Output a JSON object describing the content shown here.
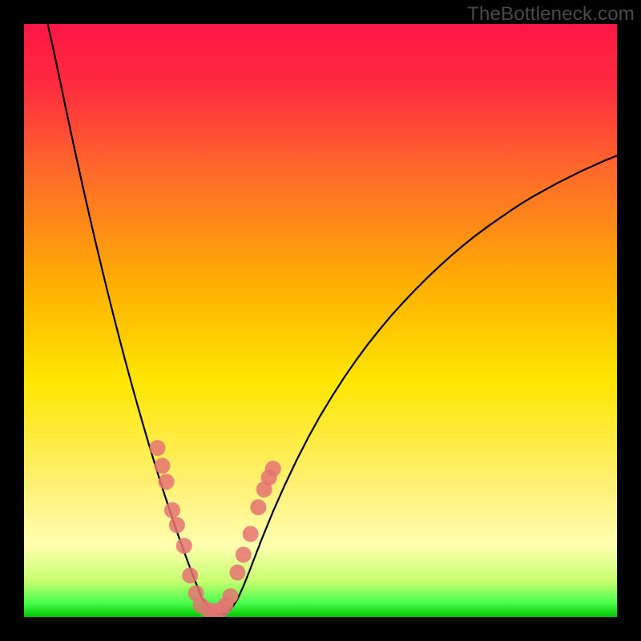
{
  "watermark": "TheBottleneck.com",
  "chart_data": {
    "type": "line",
    "title": "",
    "xlabel": "",
    "ylabel": "",
    "xlim": [
      0,
      100
    ],
    "ylim": [
      0,
      100
    ],
    "grid": false,
    "legend": false,
    "gradient_stops": [
      {
        "offset": 0.0,
        "color": "#ff1744"
      },
      {
        "offset": 0.1,
        "color": "#ff2a3f"
      },
      {
        "offset": 0.25,
        "color": "#ff6a2a"
      },
      {
        "offset": 0.45,
        "color": "#ffb300"
      },
      {
        "offset": 0.6,
        "color": "#ffe600"
      },
      {
        "offset": 0.78,
        "color": "#fff176"
      },
      {
        "offset": 0.88,
        "color": "#ffffb0"
      },
      {
        "offset": 0.94,
        "color": "#c5ff6e"
      },
      {
        "offset": 0.975,
        "color": "#4dff4d"
      },
      {
        "offset": 1.0,
        "color": "#00c800"
      }
    ],
    "series": [
      {
        "name": "curve",
        "color": "#000000",
        "stroke_width": 2.2,
        "x": [
          4,
          5,
          6,
          7,
          8,
          9,
          10,
          11,
          12,
          13,
          14,
          15,
          16,
          17,
          18,
          19,
          20,
          21,
          22,
          23,
          24,
          25,
          26,
          27,
          28,
          29,
          30,
          31,
          32,
          33,
          34,
          35,
          36,
          37,
          38,
          40,
          42,
          44,
          46,
          48,
          50,
          52,
          54,
          56,
          58,
          60,
          62,
          64,
          66,
          68,
          70,
          72,
          74,
          76,
          78,
          80,
          82,
          84,
          86,
          88,
          90,
          92,
          94,
          96,
          98,
          100
        ],
        "y": [
          100,
          95.5,
          90.8,
          86.0,
          81.3,
          76.7,
          72.2,
          67.8,
          63.5,
          59.3,
          55.2,
          51.2,
          47.3,
          43.5,
          39.8,
          36.2,
          32.7,
          29.3,
          26.0,
          22.8,
          19.7,
          16.7,
          13.8,
          11.0,
          8.3,
          5.7,
          3.2,
          1.8,
          0.9,
          0.4,
          0.6,
          1.4,
          3.0,
          5.2,
          7.7,
          12.9,
          17.8,
          22.3,
          26.5,
          30.4,
          34.0,
          37.3,
          40.4,
          43.3,
          46.0,
          48.5,
          50.9,
          53.1,
          55.2,
          57.2,
          59.1,
          60.9,
          62.6,
          64.2,
          65.7,
          67.1,
          68.5,
          69.8,
          71.0,
          72.1,
          73.2,
          74.2,
          75.2,
          76.1,
          77.0,
          77.8
        ]
      }
    ],
    "points": {
      "name": "markers",
      "color": "#e57373",
      "opacity": 0.85,
      "radius": 10,
      "x": [
        22.5,
        23.3,
        24.0,
        25.0,
        25.8,
        27.0,
        28.0,
        29.0,
        29.8,
        31.0,
        32.3,
        33.2,
        34.0,
        34.8,
        36.0,
        37.0,
        38.2,
        39.5,
        40.5,
        41.3,
        42.0
      ],
      "y": [
        28.5,
        25.5,
        22.8,
        18.0,
        15.5,
        12.0,
        7.0,
        4.0,
        2.0,
        1.2,
        1.0,
        1.2,
        2.0,
        3.5,
        7.5,
        10.5,
        14.0,
        18.5,
        21.5,
        23.5,
        25.0
      ]
    }
  }
}
